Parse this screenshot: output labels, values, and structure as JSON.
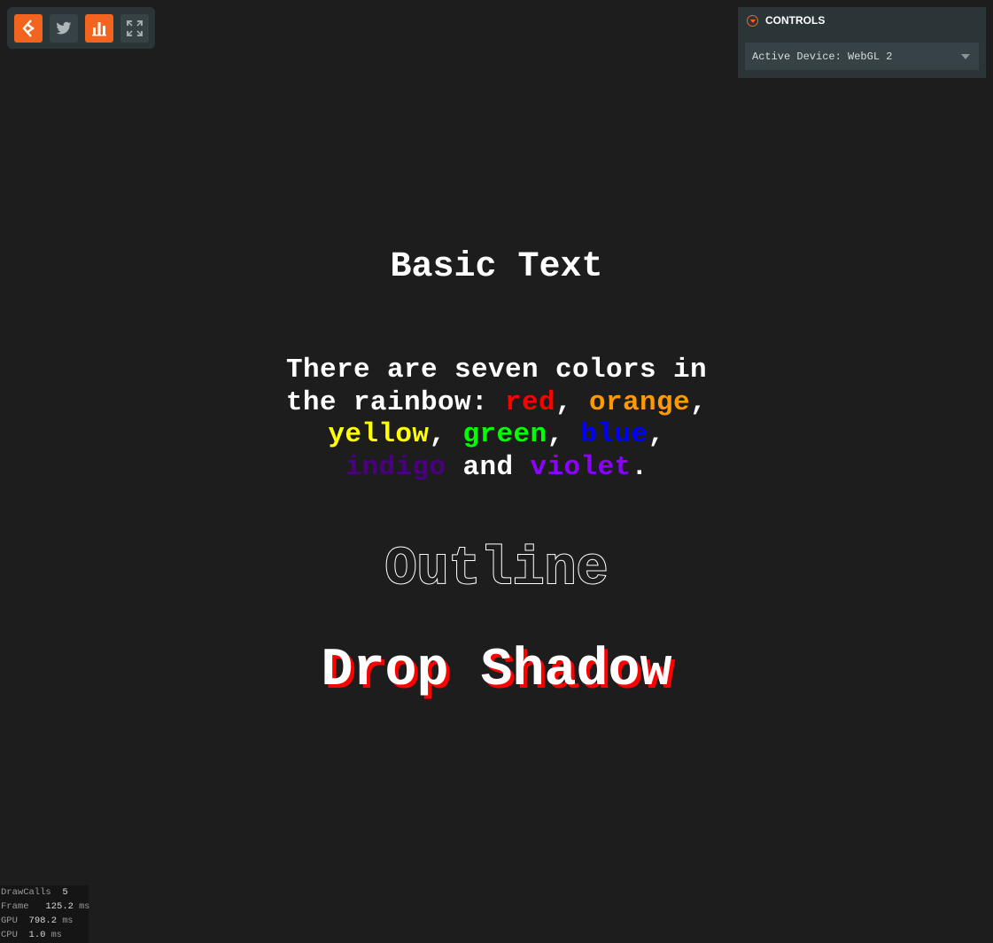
{
  "toolbar": {
    "buttons": [
      {
        "icon": "playcanvas-logo-icon",
        "color": "#f3641f"
      },
      {
        "icon": "twitter-icon",
        "color": "#364246"
      },
      {
        "icon": "stats-bar-chart-icon",
        "color": "#f3641f"
      },
      {
        "icon": "fullscreen-icon",
        "color": "#364246"
      }
    ]
  },
  "controls": {
    "title": "CONTROLS",
    "device_select_value": "Active Device: WebGL 2"
  },
  "canvas": {
    "title": "Basic Text",
    "paragraph": {
      "line1": "There are seven colors in",
      "line2_prefix": "the rainbow: ",
      "red": "red",
      "orange": "orange",
      "yellow": "yellow",
      "green": "green",
      "blue": "blue",
      "indigo": "indigo",
      "and": " and ",
      "violet": "violet",
      "comma": ",",
      "period": "."
    },
    "outline_text": "Outline",
    "drop_shadow_text": "Drop Shadow",
    "colors": {
      "red": "#ff0000",
      "orange": "#ff9900",
      "yellow": "#ffff00",
      "green": "#00ff00",
      "blue": "#0000ff",
      "indigo": "#4b0082",
      "violet": "#8b00ff",
      "shadow": "#ff0000"
    }
  },
  "stats": {
    "drawcalls_label": "DrawCalls",
    "drawcalls_value": "5",
    "frame_label": "Frame",
    "frame_value": "125.2",
    "gpu_label": "GPU",
    "gpu_value": "798.2",
    "cpu_label": "CPU",
    "cpu_value": "1.0",
    "unit": "ms"
  }
}
